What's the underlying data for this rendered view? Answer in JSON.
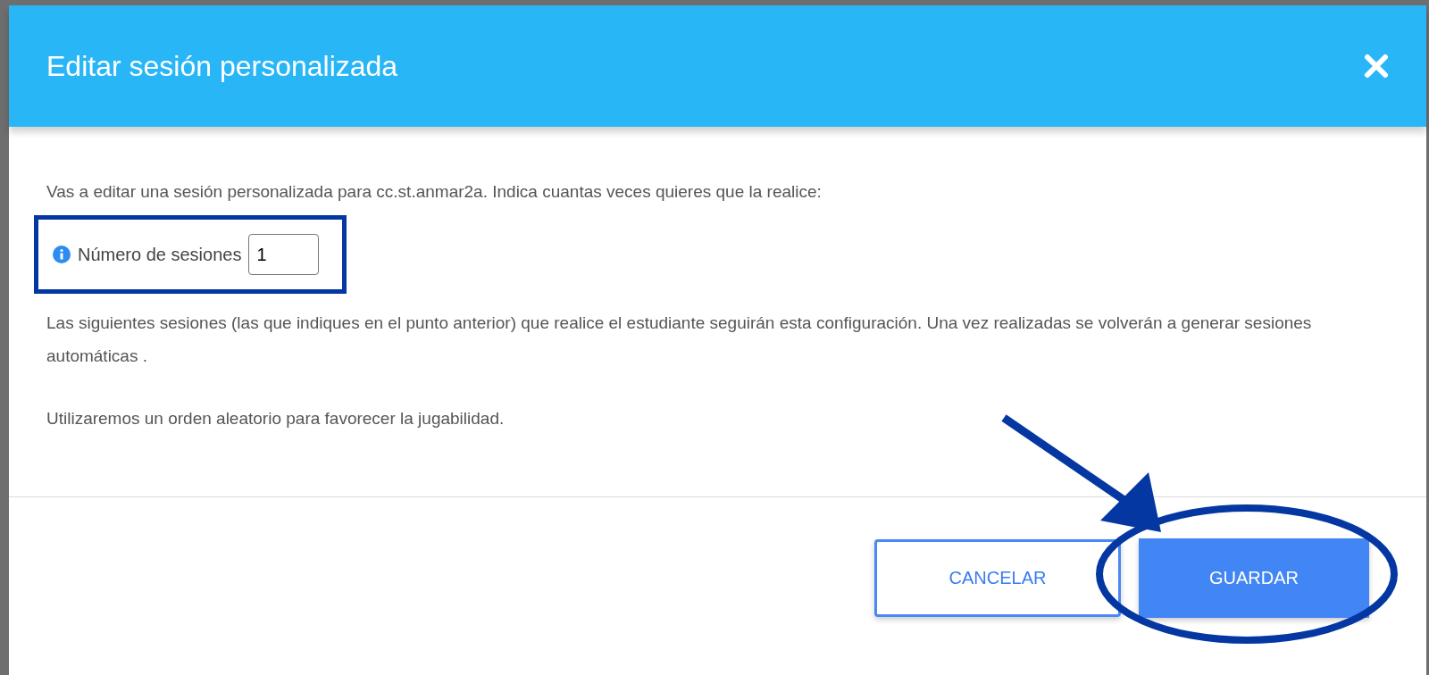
{
  "dialog": {
    "title": "Editar sesión personalizada",
    "intro": "Vas a editar una sesión personalizada para cc.st.anmar2a. Indica cuantas veces quieres que la realice:",
    "field": {
      "label": "Número de sesiones",
      "value": "1"
    },
    "paragraphs": [
      "Las siguientes sesiones (las que indiques en el punto anterior) que realice el estudiante seguirán esta configuración. Una vez realizadas se volverán a generar sesiones automáticas .",
      "Utilizaremos un orden aleatorio para favorecer la jugabilidad."
    ],
    "buttons": [
      {
        "label": "CANCELAR",
        "kind": "secondary"
      },
      {
        "label": "GUARDAR",
        "kind": "primary"
      }
    ]
  }
}
